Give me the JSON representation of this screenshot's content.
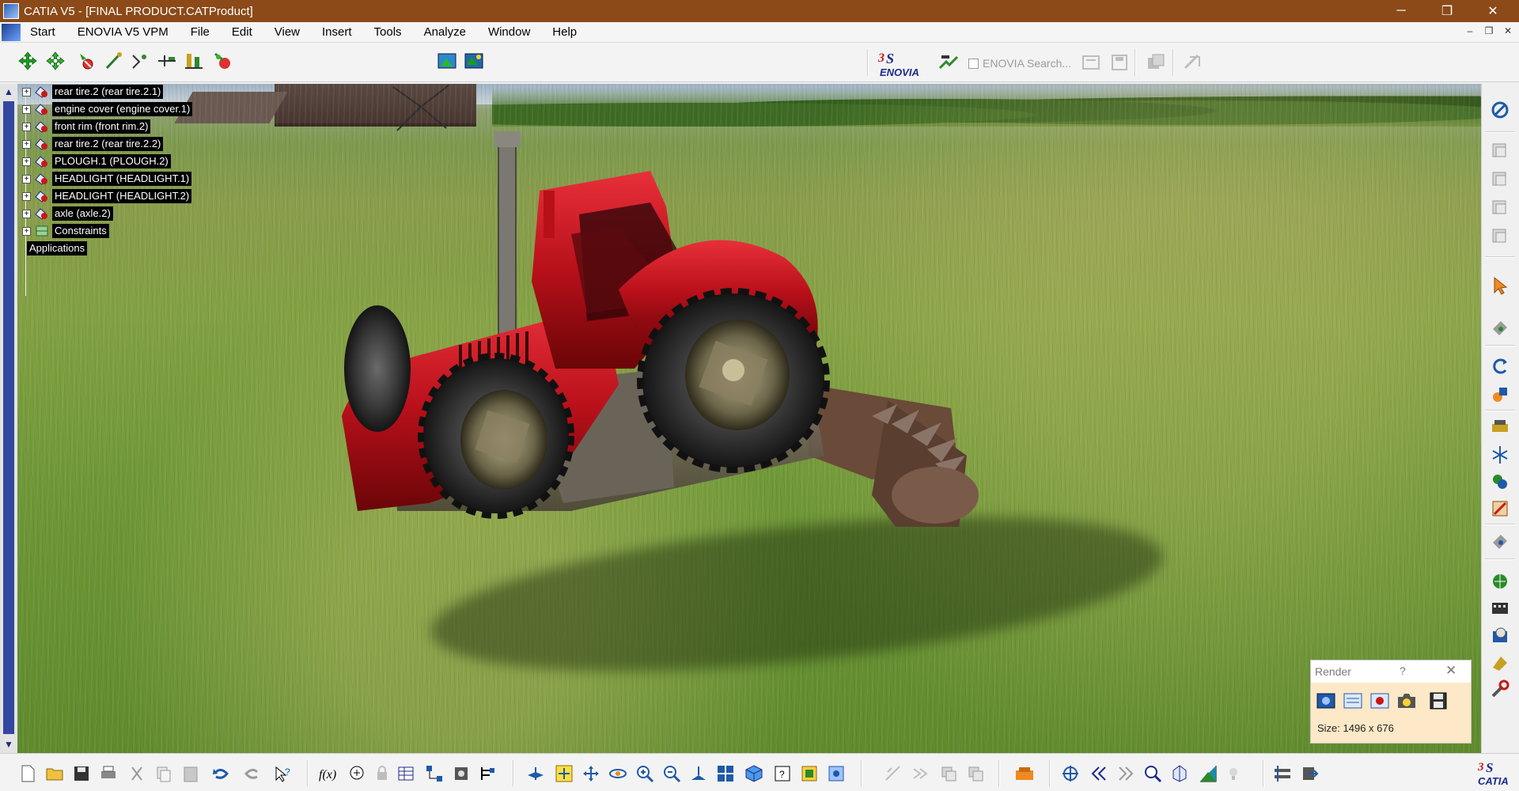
{
  "window": {
    "title": "CATIA V5 - [FINAL PRODUCT.CATProduct]",
    "minimize": "─",
    "restore": "❐",
    "close": "✕"
  },
  "menu": {
    "items": [
      "Start",
      "ENOVIA V5 VPM",
      "File",
      "Edit",
      "View",
      "Insert",
      "Tools",
      "Analyze",
      "Window",
      "Help"
    ],
    "mdi_minimize": "–",
    "mdi_restore": "❐",
    "mdi_close": "✕"
  },
  "toolbar_top": {
    "enovia_logo_text": "ENOVIA",
    "enovia_search": "ENOVIA Search..."
  },
  "tree": {
    "nodes": [
      "rear tire.2 (rear tire.2.1)",
      "engine cover (engine cover.1)",
      "front rim (front rim.2)",
      "rear tire.2 (rear tire.2.2)",
      "PLOUGH.1 (PLOUGH.2)",
      "HEADLIGHT (HEADLIGHT.1)",
      "HEADLIGHT (HEADLIGHT.2)",
      "axle (axle.2)",
      "Constraints"
    ],
    "applications": "Applications",
    "expander": "+"
  },
  "render_panel": {
    "title": "Render",
    "help": "?",
    "close": "✕",
    "size": "Size: 1496 x 676"
  },
  "branding": {
    "catia_logo_text": "CATIA"
  },
  "colors": {
    "titlebar": "#8b4a18",
    "tree_label_bg": "#000000",
    "render_panel_body": "#fde8c8",
    "tractor_red": "#c8141e"
  }
}
